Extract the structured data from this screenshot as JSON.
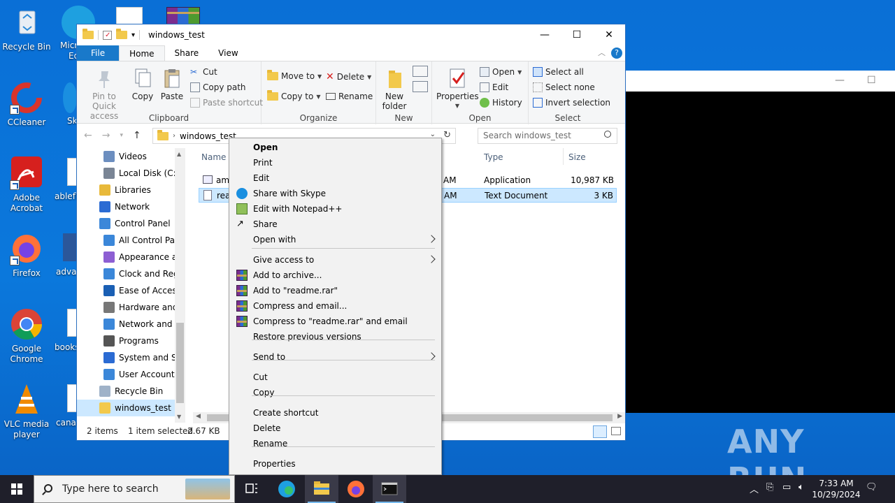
{
  "desktop": {
    "icons": [
      {
        "label": "Recycle Bin"
      },
      {
        "label": "CCleaner"
      },
      {
        "label": "Adobe Acrobat"
      },
      {
        "label": "Firefox"
      },
      {
        "label": "Google Chrome"
      },
      {
        "label": "VLC media player"
      }
    ],
    "partial_labels": [
      "Micr",
      "Ed",
      "Sk",
      "ablefla",
      "advar",
      "books",
      "canad"
    ]
  },
  "explorer": {
    "title": "windows_test",
    "tabs": [
      "File",
      "Home",
      "Share",
      "View"
    ],
    "ribbon": {
      "clipboard": {
        "label": "Clipboard",
        "pin": "Pin to Quick access",
        "copy": "Copy",
        "paste": "Paste",
        "cut": "Cut",
        "copy_path": "Copy path",
        "paste_shortcut": "Paste shortcut"
      },
      "organize": {
        "label": "Organize",
        "move_to": "Move to",
        "copy_to": "Copy to",
        "delete": "Delete",
        "rename": "Rename"
      },
      "new": {
        "label": "New",
        "new_folder": "New folder"
      },
      "open": {
        "label": "Open",
        "properties": "Properties",
        "open": "Open",
        "edit": "Edit",
        "history": "History"
      },
      "select": {
        "label": "Select",
        "select_all": "Select all",
        "select_none": "Select none",
        "invert": "Invert selection"
      }
    },
    "address": {
      "crumb": "windows_test"
    },
    "search": {
      "placeholder": "Search windows_test"
    },
    "nav": [
      {
        "label": "Videos",
        "indent": 1
      },
      {
        "label": "Local Disk (C:)",
        "indent": 1
      },
      {
        "label": "Libraries",
        "indent": 0
      },
      {
        "label": "Network",
        "indent": 0
      },
      {
        "label": "Control Panel",
        "indent": 0
      },
      {
        "label": "All Control Par",
        "indent": 1
      },
      {
        "label": "Appearance an",
        "indent": 1
      },
      {
        "label": "Clock and Regi",
        "indent": 1
      },
      {
        "label": "Ease of Access",
        "indent": 1
      },
      {
        "label": "Hardware and",
        "indent": 1
      },
      {
        "label": "Network and Ir",
        "indent": 1
      },
      {
        "label": "Programs",
        "indent": 1
      },
      {
        "label": "System and Se",
        "indent": 1
      },
      {
        "label": "User Accounts",
        "indent": 1
      },
      {
        "label": "Recycle Bin",
        "indent": 0
      },
      {
        "label": "windows_test",
        "indent": 0
      }
    ],
    "columns": {
      "name": "Name",
      "type": "Type",
      "size": "Size"
    },
    "files": [
      {
        "name": "amo",
        "date_tail": "AM",
        "type": "Application",
        "size": "10,987 KB"
      },
      {
        "name": "read",
        "date_tail": "AM",
        "type": "Text Document",
        "size": "3 KB"
      }
    ],
    "status": {
      "items": "2 items",
      "selected": "1 item selected",
      "size": "2.67 KB"
    }
  },
  "context_menu": {
    "items": [
      {
        "label": "Open",
        "bold": true
      },
      {
        "label": "Print"
      },
      {
        "label": "Edit"
      },
      {
        "label": "Share with Skype",
        "icon": "skype-icon"
      },
      {
        "label": "Edit with Notepad++",
        "icon": "notepadpp-icon"
      },
      {
        "label": "Share",
        "icon": "share-icon"
      },
      {
        "label": "Open with",
        "submenu": true
      },
      {
        "label": "Give access to",
        "submenu": true
      },
      {
        "label": "Add to archive...",
        "icon": "winrar-icon"
      },
      {
        "label": "Add to \"readme.rar\"",
        "icon": "winrar-icon"
      },
      {
        "label": "Compress and email...",
        "icon": "winrar-icon"
      },
      {
        "label": "Compress to \"readme.rar\" and email",
        "icon": "winrar-icon"
      },
      {
        "label": "Restore previous versions"
      },
      {
        "label": "Send to",
        "submenu": true
      },
      {
        "label": "Cut"
      },
      {
        "label": "Copy"
      },
      {
        "label": "Create shortcut"
      },
      {
        "label": "Delete"
      },
      {
        "label": "Rename"
      },
      {
        "label": "Properties"
      }
    ]
  },
  "taskbar": {
    "search_placeholder": "Type here to search",
    "time": "7:33 AM",
    "date": "10/29/2024"
  },
  "watermark": "ANY RUN"
}
